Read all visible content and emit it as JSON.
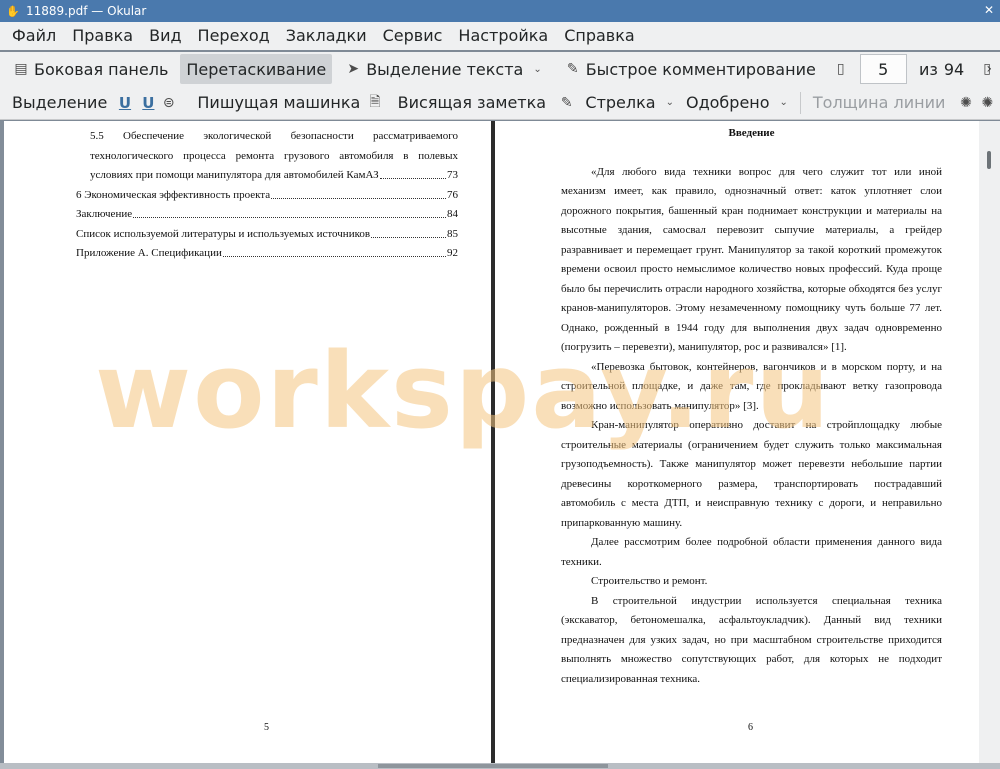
{
  "window": {
    "title": "11889.pdf  — Okular"
  },
  "menu": [
    "Файл",
    "Правка",
    "Вид",
    "Переход",
    "Закладки",
    "Сервис",
    "Настройка",
    "Справка"
  ],
  "toolbar1": {
    "sidebar": "Боковая панель",
    "drag": "Перетаскивание",
    "text_select": "Выделение текста",
    "quick_comment": "Быстрое комментирование",
    "page_current": "5",
    "page_of": "из",
    "page_total": "94"
  },
  "toolbar2": {
    "highlight": "Выделение",
    "typewriter": "Пишущая машинка",
    "sticky_note": "Висящая заметка",
    "arrow": "Стрелка",
    "stamp": "Одобрено",
    "line_width": "Толщина линии"
  },
  "left_page": {
    "toc": [
      {
        "text": "5.5 Обеспечение экологической безопасности рассматриваемого",
        "page": "",
        "indent": true,
        "justify": true
      },
      {
        "text": "технологического процесса ремонта грузового автомобиля в полевых",
        "page": "",
        "indent": true,
        "justify": true
      },
      {
        "text": "условиях при помощи манипулятора для автомобилей КамАЗ",
        "page": "73",
        "indent": true
      },
      {
        "text": "6 Экономическая эффективность проекта",
        "page": "76",
        "indent": false
      },
      {
        "text": "Заключение",
        "page": "84",
        "indent": false
      },
      {
        "text": "Список используемой литературы и используемых источников",
        "page": "85",
        "indent": false
      },
      {
        "text": "Приложение А. Спецификации",
        "page": "92",
        "indent": false
      }
    ],
    "page_number": "5"
  },
  "right_page": {
    "heading": "Введение",
    "paragraphs": [
      "«Для любого вида техники вопрос для чего служит тот или иной механизм имеет, как правило, однозначный ответ: каток уплотняет слои дорожного покрытия, башенный кран поднимает конструкции и материалы на высотные здания, самосвал перевозит сыпучие материалы, а грейдер разравнивает и перемещает грунт. Манипулятор за такой короткий промежуток времени освоил просто немыслимое количество новых профессий. Куда проще было бы перечислить отрасли народного хозяйства, которые обходятся без услуг кранов-манипуляторов. Этому незамеченному помощнику чуть больше 77 лет. Однако, рожденный в 1944 году для выполнения двух задач одновременно (погрузить – перевезти), манипулятор, рос и развивался» [1].",
      "«Перевозка бытовок, контейнеров, вагончиков и в морском порту, и на строительной площадке, и даже там, где прокладывают ветку газопровода возможно использовать манипулятор» [3].",
      "Кран-манипулятор оперативно доставит на стройплощадку любые строительные материалы (ограничением будет служить только максимальная грузоподъемность). Также манипулятор может перевезти небольшие партии древесины короткомерного размера, транспортировать пострадавший автомобиль с места ДТП, и неисправную технику с дороги, и неправильно припаркованную машину.",
      "Далее рассмотрим более подробной области применения данного вида техники.",
      "Строительство и ремонт.",
      "В строительной индустрии используется специальная техника (экскаватор, бетономешалка, асфальтоукладчик). Данный вид техники предназначен для узких задач, но при масштабном строительстве приходится выполнять множество сопутствующих работ, для которых не подходит специализированная техника."
    ],
    "page_number": "6"
  },
  "watermark": "workspay.ru"
}
